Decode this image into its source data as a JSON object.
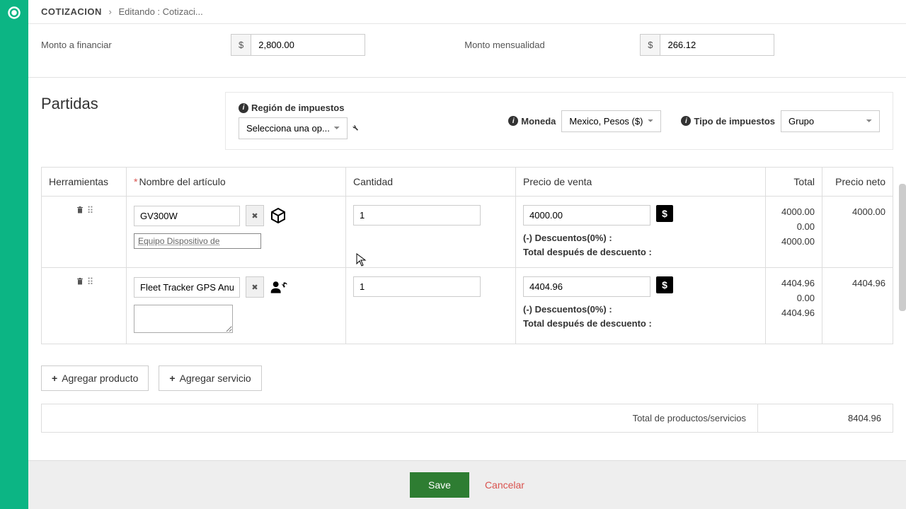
{
  "breadcrumb": {
    "title": "COTIZACION",
    "subtitle": "Editando : Cotizaci..."
  },
  "financing": {
    "amount_label": "Monto a financiar",
    "amount_value": "2,800.00",
    "monthly_label": "Monto mensualidad",
    "monthly_value": "266.12",
    "currency_symbol": "$"
  },
  "partidas": {
    "title": "Partidas",
    "tax_region_label": "Región de impuestos",
    "tax_region_value": "Selecciona una op...",
    "currency_label": "Moneda",
    "currency_value": "Mexico, Pesos ($)",
    "tax_type_label": "Tipo de impuestos",
    "tax_type_value": "Grupo"
  },
  "table": {
    "headers": {
      "tools": "Herramientas",
      "article": "Nombre del artículo",
      "qty": "Cantidad",
      "price": "Precio de venta",
      "total": "Total",
      "net": "Precio neto"
    },
    "rows": [
      {
        "article": "GV300W",
        "description": "Equipo Dispositivo de",
        "qty": "1",
        "price": "4000.00",
        "discount_label": "(-) Descuentos(0%) :",
        "after_discount_label": "Total después de descuento :",
        "total": "4000.00",
        "discount_amt": "0.00",
        "after_discount": "4000.00",
        "net": "4000.00",
        "type": "product"
      },
      {
        "article": "Fleet Tracker GPS Anual A",
        "description": "",
        "qty": "1",
        "price": "4404.96",
        "discount_label": "(-) Descuentos(0%) :",
        "after_discount_label": "Total después de descuento :",
        "total": "4404.96",
        "discount_amt": "0.00",
        "after_discount": "4404.96",
        "net": "4404.96",
        "type": "service"
      }
    ]
  },
  "actions": {
    "add_product": "Agregar producto",
    "add_service": "Agregar servicio"
  },
  "summary": {
    "total_label": "Total de productos/servicios",
    "total_value": "8404.96"
  },
  "footer": {
    "save": "Save",
    "cancel": "Cancelar"
  }
}
